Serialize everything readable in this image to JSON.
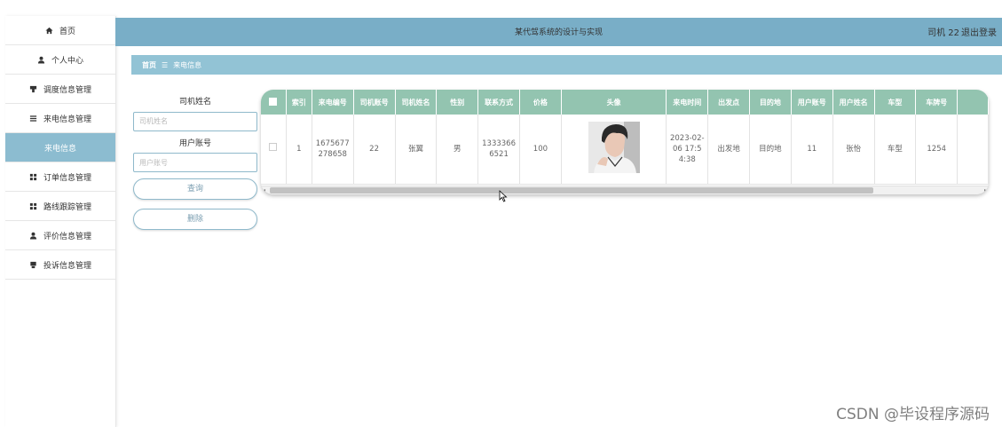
{
  "sidebar": {
    "items": [
      {
        "label": "首页",
        "icon": "home-icon"
      },
      {
        "label": "个人中心",
        "icon": "user-icon"
      },
      {
        "label": "调度信息管理",
        "icon": "dispatch-icon"
      },
      {
        "label": "来电信息管理",
        "icon": "list-icon"
      },
      {
        "label": "来电信息",
        "icon": ""
      },
      {
        "label": "订单信息管理",
        "icon": "grid-icon"
      },
      {
        "label": "路线跟踪管理",
        "icon": "grid-icon"
      },
      {
        "label": "评价信息管理",
        "icon": "user-icon"
      },
      {
        "label": "投诉信息管理",
        "icon": "print-icon"
      }
    ],
    "active_index": 4,
    "active_color": "#8cbcd0"
  },
  "header": {
    "title": "某代驾系统的设计与实现",
    "user": "司机 22",
    "logout": "退出登录",
    "bg_color": "#79aec7"
  },
  "breadcrumb": {
    "home": "首页",
    "separator": "☰",
    "current": "来电信息"
  },
  "search": {
    "driver_name_label": "司机姓名",
    "driver_name_placeholder": "司机姓名",
    "user_account_label": "用户账号",
    "user_account_placeholder": "用户账号",
    "query_button": "查询",
    "delete_button": "删除"
  },
  "table": {
    "header_color": "#93c4b0",
    "columns": [
      "索引",
      "来电编号",
      "司机账号",
      "司机姓名",
      "性别",
      "联系方式",
      "价格",
      "头像",
      "来电时间",
      "出发点",
      "目的地",
      "用户账号",
      "用户姓名",
      "车型",
      "车牌号"
    ],
    "rows": [
      [
        "1",
        "1675677278658",
        "22",
        "张翼",
        "男",
        "13333666521",
        "100",
        "",
        "2023-02-06 17:54:38",
        "出发地",
        "目的地",
        "11",
        "张怡",
        "车型",
        "1254"
      ]
    ]
  },
  "watermark": "CSDN @毕设程序源码"
}
